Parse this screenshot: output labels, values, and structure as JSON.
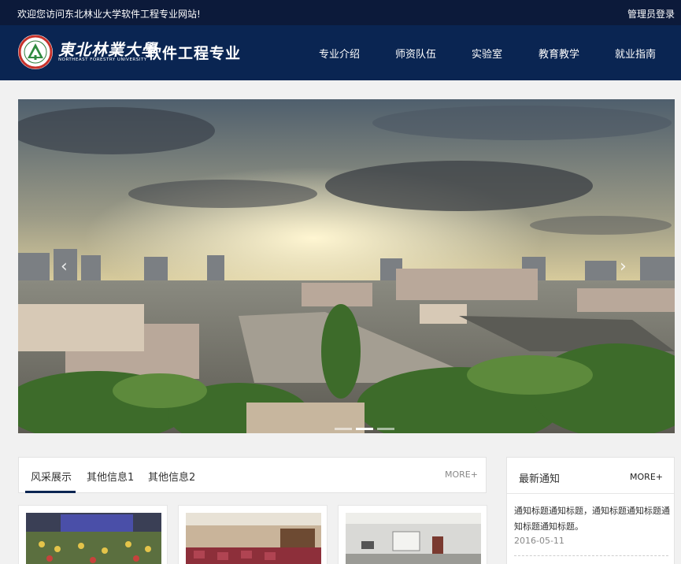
{
  "topbar": {
    "welcome": "欢迎您访问东北林业大学软件工程专业网站!",
    "admin": "管理员登录"
  },
  "logo": {
    "university_cn": "東北林業大學",
    "university_en": "NORTHEAST FORESTRY UNIVERSITY",
    "major": "软件工程专业"
  },
  "nav": {
    "items": [
      {
        "label": "专业介绍"
      },
      {
        "label": "师资队伍"
      },
      {
        "label": "实验室"
      },
      {
        "label": "教育教学"
      },
      {
        "label": "就业指南"
      }
    ]
  },
  "banner": {
    "slides_total": 3,
    "active_slide": 2,
    "prev_glyph": "‹",
    "next_glyph": "›"
  },
  "tabs": {
    "items": [
      {
        "label": "风采展示",
        "active": true
      },
      {
        "label": "其他信息1",
        "active": false
      },
      {
        "label": "其他信息2",
        "active": false
      }
    ],
    "more": "MORE+"
  },
  "notice": {
    "title": "最新通知",
    "more": "MORE+",
    "items": [
      {
        "text": "通知标题通知标题，通知标题通知标题通知标题通知标题。",
        "date": "2016-05-11"
      }
    ]
  },
  "colors": {
    "topbar": "#0c1a3a",
    "navbar": "#0a2552",
    "accent": "#0a2552"
  },
  "icons": {
    "seal": "university-seal-icon",
    "prev": "chevron-left-icon",
    "next": "chevron-right-icon"
  }
}
